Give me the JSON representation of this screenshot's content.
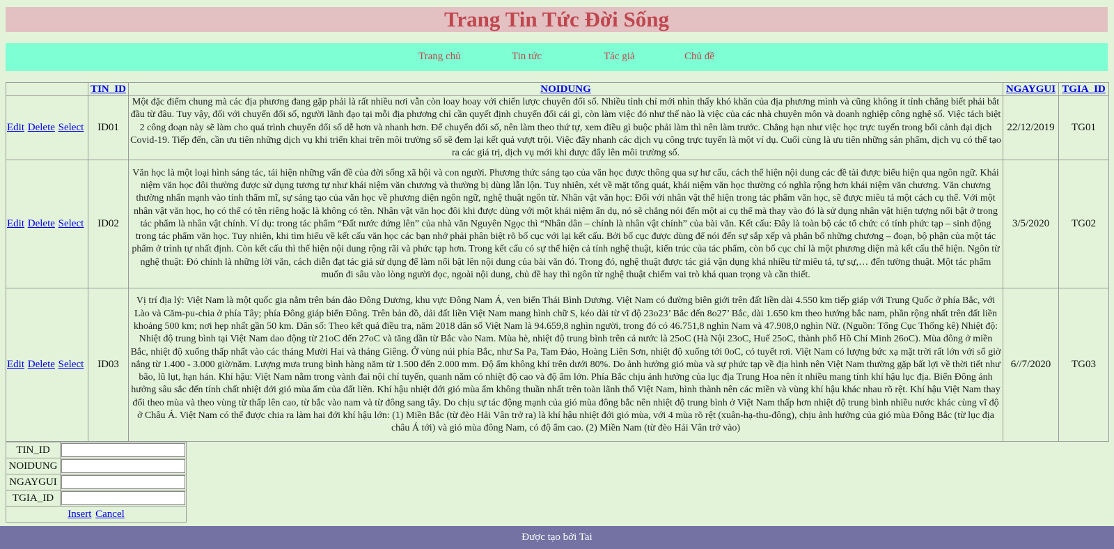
{
  "header": {
    "title": "Trang Tin Tức Đời Sống"
  },
  "nav": {
    "items": [
      "Trang chủ",
      "Tin tức",
      "Tác giả",
      "Chủ đề"
    ]
  },
  "table": {
    "columns": [
      "",
      "TIN_ID",
      "NOIDUNG",
      "NGAYGUI",
      "TGIA_ID"
    ],
    "actions": {
      "edit": "Edit",
      "delete": "Delete",
      "select": "Select"
    },
    "rows": [
      {
        "tin_id": "ID01",
        "noidung": "Một đặc điểm chung mà các địa phương đang gặp phải là rất nhiều nơi vẫn còn loay hoay với chiến lược chuyển đổi số. Nhiều tỉnh chỉ mới nhìn thấy khó khăn của địa phương mình và cũng không ít tỉnh chẳng biết phải bắt đầu từ đâu. Tuy vậy, đối với chuyển đổi số, người lãnh đạo tại mỗi địa phương chỉ cần quyết định chuyển đổi cái gì, còn làm việc đó như thế nào là việc của các nhà chuyên môn và doanh nghiệp công nghệ số. Việc tách biệt 2 công đoạn này sẽ làm cho quá trình chuyển đổi số dễ hơn và nhanh hơn. Để chuyển đổi số, nên làm theo thứ tự, xem điều gì buộc phải làm thì nên làm trước. Chẳng hạn như việc học trực tuyến trong bối cảnh đại dịch Covid-19. Tiếp đến, cần ưu tiên những dịch vụ khi triển khai trên môi trường số sẽ đem lại kết quả vượt trội. Việc đẩy nhanh các dịch vụ công trực tuyến là một ví dụ. Cuối cùng là ưu tiên những sản phẩm, dịch vụ có thể tạo ra các giá trị, dịch vụ mới khi được đẩy lên môi trường số.",
        "ngaygui": "22/12/2019",
        "tgia_id": "TG01"
      },
      {
        "tin_id": "ID02",
        "noidung": "Văn học là một loại hình sáng tác, tái hiện những vấn đề của đời sống xã hội và con người. Phương thức sáng tạo của văn học được thông qua sự hư cấu, cách thể hiện nội dung các đề tài được biểu hiện qua ngôn ngữ. Khái niệm văn học đôi thường được sử dụng tương tự như khái niệm văn chương và thường bị dùng lẫn lộn. Tuy nhiên, xét về mặt tổng quát, khái niệm văn học thường có nghĩa rộng hơn khái niệm văn chương. Văn chương thường nhấn mạnh vào tính thẩm mĩ, sự sáng tạo của văn học về phương diện ngôn ngữ, nghệ thuật ngôn từ. Nhân vật văn học: Đối với nhân vật thể hiện trong tác phẩm văn học, sẽ được miêu tả một cách cụ thể. Với một nhân vật văn học, họ có thể có tên riêng hoặc là không có tên. Nhân vật văn học đôi khi được dùng với một khái niệm ẩn dụ, nó sẽ chẳng nói đến một ai cụ thể mà thay vào đó là sử dụng nhân vật hiện tượng nổi bật ở trong tác phẩm là nhân vật chính. Ví dụ: trong tác phẩm “Đất nước đứng lên” của nhà văn Nguyên Ngọc thì “Nhân dân – chính là nhân vật chính” của bài văn. Kết cấu: Đây là toàn bộ các tổ chức có tính phức tạp – sinh động trong tác phẩm văn học. Tuy nhiên, khi tìm hiểu về kết cấu văn học các bạn nhớ phải phân biệt rõ bố cục với lại kết cấu. Bởi bố cục được dùng để nói đến sự sắp xếp và phân bố những chương – đoạn, bộ phận của một tác phẩm ở trình tự nhất định. Còn kết cấu thì thể hiện nội dung rộng rãi và phức tạp hơn. Trong kết cấu có sự thể hiện cả tính nghệ thuật, kiến trúc của tác phẩm, còn bố cục chỉ là một phương diện mà kết cấu thể hiện. Ngôn từ nghệ thuật: Đó chính là những lời văn, cách diễn đạt tác giả sử dụng để làm nổi bật lên nội dung của bài văn đó. Trong đó, nghệ thuật được tác giả vận dụng khá nhiều từ miêu tả, tự sự,… đến tường thuật. Một tác phẩm muốn đi sâu vào lòng người đọc, ngoài nội dung, chủ đề hay thì ngôn từ nghệ thuật chiếm vai trò khá quan trọng và cần thiết.",
        "ngaygui": "3/5/2020",
        "tgia_id": "TG02"
      },
      {
        "tin_id": "ID03",
        "noidung": "Vị trí địa lý: Việt Nam là một quốc gia nằm trên bán đảo Đông Dương, khu vực Đông Nam Á, ven biển Thái Bình Dương. Việt Nam có đường biên giới trên đất liền dài 4.550 km tiếp giáp với Trung Quốc ở phía Bắc, với Lào và Căm-pu-chia ở phía Tây; phía Đông giáp biển Đông. Trên bản đồ, dải đất liền Việt Nam mang hình chữ S, kéo dài từ vĩ độ 23o23’ Bắc đến 8o27’ Bắc, dài 1.650 km theo hướng bắc nam, phần rộng nhất trên đất liền khoảng 500 km; nơi hẹp nhất gần 50 km. Dân số: Theo kết quả điều tra, năm 2018 dân số Việt Nam là 94.659,8 nghìn người, trong đó có 46.751,8 nghìn Nam và 47.908,0 nghìn Nữ. (Nguồn: Tổng Cục Thống kê) Nhiệt độ: Nhiệt độ trung bình tại Việt Nam dao động từ 21oC đến 27oC và tăng dần từ Bắc vào Nam. Mùa hè, nhiệt độ trung bình trên cả nước là 25oC (Hà Nội 23oC, Huế 25oC, thành phố Hồ Chí Minh 26oC). Mùa đông ở miền Bắc, nhiệt độ xuống thấp nhất vào các tháng Mười Hai và tháng Giêng. Ở vùng núi phía Bắc, như Sa Pa, Tam Đảo, Hoàng Liên Sơn, nhiệt độ xuống tới 0oC, có tuyết rơi. Việt Nam có lượng bức xạ mặt trời rất lớn với số giờ nắng từ 1.400 - 3.000 giờ/năm. Lượng mưa trung bình hàng năm từ 1.500 đến 2.000 mm. Độ ẩm không khí trên dưới 80%. Do ảnh hưởng gió mùa và sự phức tạp về địa hình nên Việt Nam thường gặp bất lợi về thời tiết như bão, lũ lụt, hạn hán. Khí hậu: Việt Nam nằm trong vành đai nội chí tuyến, quanh năm có nhiệt độ cao và độ ẩm lớn. Phía Bắc chịu ảnh hưởng của lục địa Trung Hoa nên ít nhiều mang tính khí hậu lục địa. Biển Đông ảnh hưởng sâu sắc đến tính chất nhiệt đới gió mùa ẩm của đất liền. Khí hậu nhiệt đới gió mùa ẩm không thuần nhất trên toàn lãnh thổ Việt Nam, hình thành nên các miền và vùng khí hậu khác nhau rõ rệt. Khí hậu Việt Nam thay đổi theo mùa và theo vùng từ thấp lên cao, từ bắc vào nam và từ đông sang tây. Do chịu sự tác động mạnh của gió mùa đông bắc nên nhiệt độ trung bình ở Việt Nam thấp hơn nhiệt độ trung bình nhiều nước khác cùng vĩ độ ở Châu Á. Việt Nam có thể được chia ra làm hai đới khí hậu lớn: (1) Miền Bắc (từ đèo Hải Vân trở ra) là khí hậu nhiệt đới gió mùa, với 4 mùa rõ rệt (xuân-hạ-thu-đông), chịu ảnh hưởng của gió mùa Đông Bắc (từ lục địa châu Á tới) và gió mùa đông Nam, có độ ẩm cao. (2) Miền Nam (từ đèo Hải Vân trở vào)",
        "ngaygui": "6//7/2020",
        "tgia_id": "TG03"
      }
    ]
  },
  "form": {
    "labels": [
      "TIN_ID",
      "NOIDUNG",
      "NGAYGUI",
      "TGIA_ID"
    ],
    "insert_label": "Insert",
    "cancel_label": "Cancel"
  },
  "footer": {
    "text": "Được tạo bởi Tai"
  },
  "colors": {
    "background": "#e2f3d9",
    "header_bg": "#e3c1c3",
    "title": "#c0474e",
    "nav_bg": "#7fffd4",
    "footer_bg": "#7472a3",
    "link": "#0000ee"
  }
}
